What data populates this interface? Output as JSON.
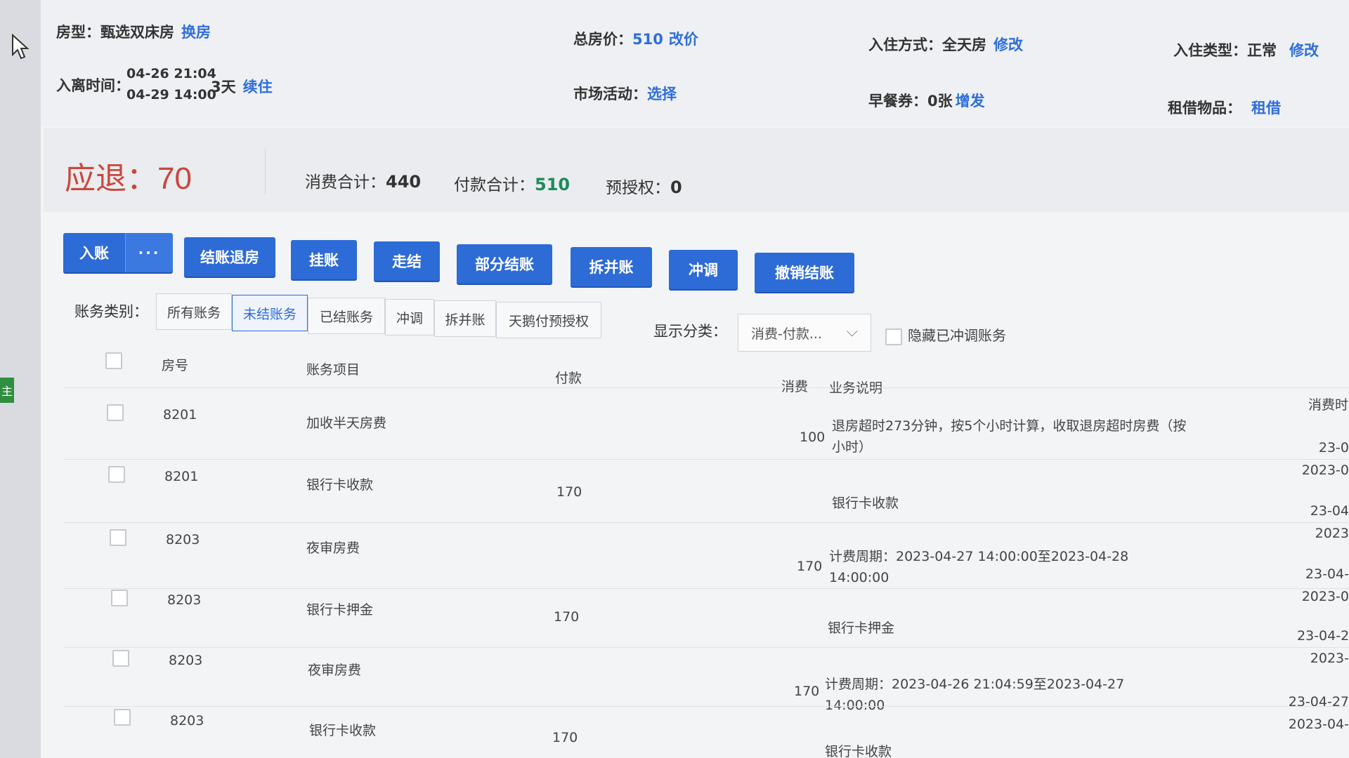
{
  "header": {
    "room_type_label": "房型：",
    "room_type_value": "甄选双床房",
    "change_room": "换房",
    "time_label": "入离时间：",
    "checkin_time": "04-26 21:04",
    "checkout_time": "04-29 14:00",
    "nights": "3天",
    "extend": "续住",
    "total_price_label": "总房价：",
    "total_price_value": "510",
    "change_price": "改价",
    "market_label": "市场活动：",
    "market_select": "选择",
    "checkin_mode_label": "入住方式：",
    "checkin_mode_value": "全天房",
    "checkin_mode_edit": "修改",
    "breakfast_label": "早餐券：",
    "breakfast_value": "0张",
    "breakfast_add": "增发",
    "checkin_type_label": "入住类型：",
    "checkin_type_value": "正常",
    "checkin_type_edit": "修改",
    "rental_label": "租借物品：",
    "rental_action": "租借"
  },
  "summary": {
    "refund": "应退：70",
    "consumption_label": "消费合计：",
    "consumption_value": "440",
    "payment_label": "付款合计：",
    "payment_value": "510",
    "preauth_label": "预授权：",
    "preauth_value": "0"
  },
  "actions": {
    "post": "入账",
    "more": "···",
    "checkout": "结账退房",
    "hang": "挂账",
    "walk": "走结",
    "partial": "部分结账",
    "split": "拆并账",
    "adjust": "冲调",
    "undo": "撤销结账"
  },
  "filters": {
    "category_label": "账务类别：",
    "tabs": [
      "所有账务",
      "未结账务",
      "已结账务",
      "冲调",
      "拆并账",
      "天鹅付预授权"
    ],
    "display_label": "显示分类：",
    "display_value": "消费-付款...",
    "hide_adjusted": "隐藏已冲调账务"
  },
  "table": {
    "headers": {
      "room": "房号",
      "item": "账务项目",
      "pay": "付款",
      "consume": "消费",
      "desc": "业务说明",
      "time": "消费时"
    },
    "rows": [
      {
        "room": "8201",
        "item": "加收半天房费",
        "pay": "",
        "consume": "100",
        "desc": "退房超时273分钟，按5个小时计算，收取退房超时房费（按小时）",
        "t1": "23-0",
        "t2": "2023-0"
      },
      {
        "room": "8201",
        "item": "银行卡收款",
        "pay": "170",
        "consume": "",
        "desc": "银行卡收款",
        "t1": "23-04",
        "t2": "2023"
      },
      {
        "room": "8203",
        "item": "夜审房费",
        "pay": "",
        "consume": "170",
        "desc": "计费周期：2023-04-27 14:00:00至2023-04-28 14:00:00",
        "t1": "23-04-",
        "t2": "2023-0"
      },
      {
        "room": "8203",
        "item": "银行卡押金",
        "pay": "170",
        "consume": "",
        "desc": "银行卡押金",
        "t1": "23-04-2",
        "t2": "2023-"
      },
      {
        "room": "8203",
        "item": "夜审房费",
        "pay": "",
        "consume": "170",
        "desc": "计费周期：2023-04-26 21:04:59至2023-04-27 14:00:00",
        "t1": "23-04-27",
        "t2": "2023-04-"
      },
      {
        "room": "8203",
        "item": "银行卡收款",
        "pay": "170",
        "consume": "",
        "desc": "银行卡收款",
        "t1": "",
        "t2": ""
      }
    ]
  },
  "side_tab": "主"
}
